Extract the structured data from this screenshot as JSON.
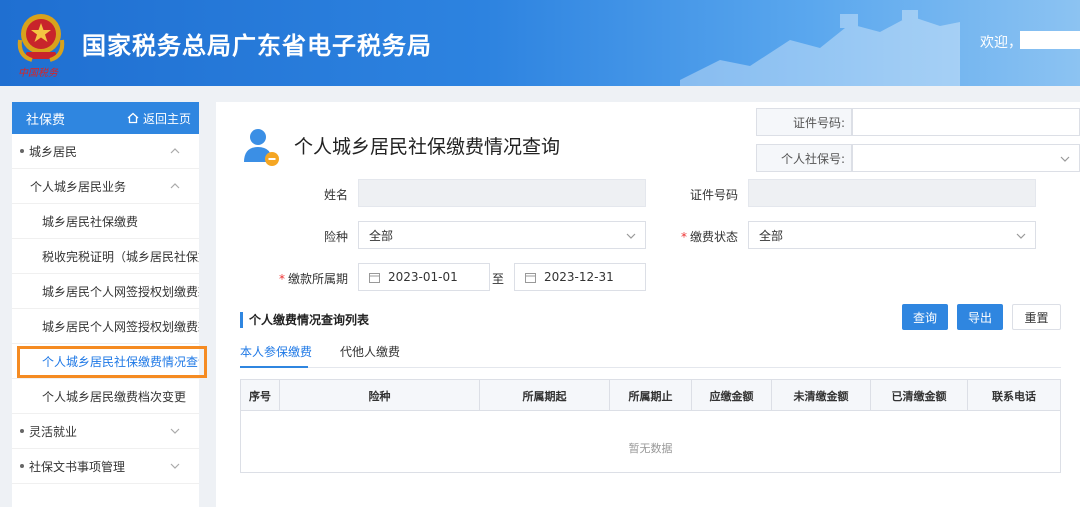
{
  "header": {
    "title": "国家税务总局广东省电子税务局",
    "emblem_caption": "中国税务",
    "welcome": "欢迎，"
  },
  "sidebar": {
    "title": "社保费",
    "home_label": "返回主页",
    "items": [
      {
        "label": "城乡居民",
        "level": 1,
        "expanded": true
      },
      {
        "label": "个人城乡居民业务",
        "level": 2,
        "expanded": true
      },
      {
        "label": "城乡居民社保缴费",
        "level": 3
      },
      {
        "label": "税收完税证明（城乡居民社保文",
        "level": 3
      },
      {
        "label": "城乡居民个人网签授权划缴费款",
        "level": 3
      },
      {
        "label": "城乡居民个人网签授权划缴费款",
        "level": 3
      },
      {
        "label": "个人城乡居民社保缴费情况查询",
        "level": 3,
        "active": true
      },
      {
        "label": "个人城乡居民缴费档次变更",
        "level": 3
      },
      {
        "label": "灵活就业",
        "level": 1,
        "expanded": false
      },
      {
        "label": "社保文书事项管理",
        "level": 1,
        "expanded": false
      }
    ]
  },
  "page": {
    "title": "个人城乡居民社保缴费情况查询",
    "top_fields": {
      "id_label": "证件号码:",
      "social_label": "个人社保号:"
    },
    "form": {
      "name_label": "姓名",
      "id_label": "证件号码",
      "insurance_label": "险种",
      "insurance_value": "全部",
      "status_label": "缴费状态",
      "status_value": "全部",
      "period_label": "缴款所属期",
      "period_start": "2023-01-01",
      "period_sep": "至",
      "period_end": "2023-12-31"
    },
    "buttons": {
      "query": "查询",
      "export": "导出",
      "reset": "重置"
    },
    "list_title": "个人缴费情况查询列表",
    "tabs": [
      "本人参保缴费",
      "代他人缴费"
    ],
    "table": {
      "columns": [
        "序号",
        "险种",
        "所属期起",
        "所属期止",
        "应缴金额",
        "未清缴金额",
        "已清缴金额",
        "联系电话"
      ],
      "empty_text": "暂无数据"
    }
  },
  "colors": {
    "primary": "#2f86e0",
    "highlight": "#f58b22",
    "required": "#e33333"
  }
}
